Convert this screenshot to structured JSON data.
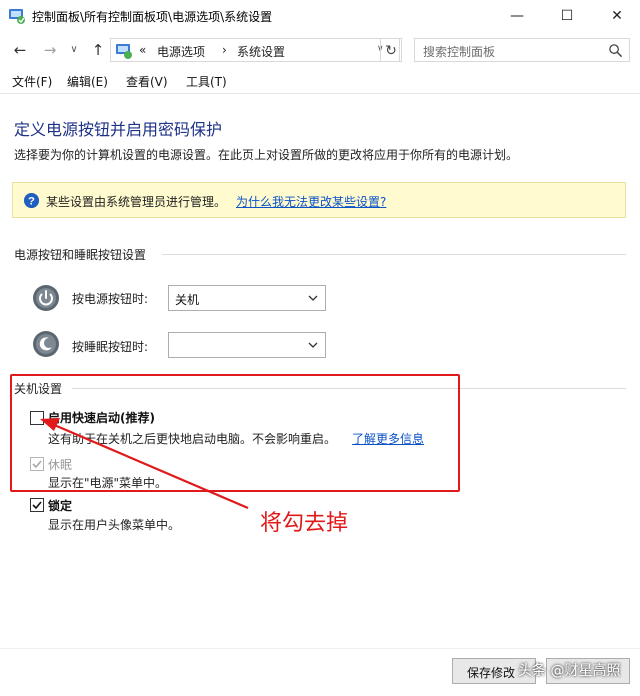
{
  "window": {
    "title": "控制面板\\所有控制面板项\\电源选项\\系统设置",
    "minimize": "—",
    "maximize": "☐",
    "close": "✕"
  },
  "nav": {
    "back": "←",
    "forward": "→",
    "dropdown": "∨",
    "up": "↑",
    "chevron": "«",
    "crumb1": "电源选项",
    "separator": "›",
    "crumb2": "系统设置",
    "address_dropdown": "∨",
    "refresh": "↻",
    "search_placeholder": "搜索控制面板"
  },
  "menu": [
    "文件(F)",
    "编辑(E)",
    "查看(V)",
    "工具(T)"
  ],
  "page": {
    "title": "定义电源按钮并启用密码保护",
    "description": "选择要为你的计算机设置的电源设置。在此页上对设置所做的更改将应用于你所有的电源计划。"
  },
  "info_bar": {
    "text": "某些设置由系统管理员进行管理。",
    "link": "为什么我无法更改某些设置?"
  },
  "buttons_section": {
    "heading": "电源按钮和睡眠按钮设置",
    "power_label": "按电源按钮时:",
    "power_value": "关机",
    "sleep_label": "按睡眠按钮时:",
    "sleep_value": ""
  },
  "shutdown_section": {
    "heading": "关机设置",
    "options": [
      {
        "label": "启用快速启动(推荐)",
        "checked": false,
        "enabled": true,
        "desc": "这有助于在关机之后更快地启动电脑。不会影响重启。",
        "link": "了解更多信息"
      },
      {
        "label": "休眠",
        "checked": true,
        "enabled": false,
        "desc": "显示在\"电源\"菜单中。"
      },
      {
        "label": "锁定",
        "checked": true,
        "enabled": true,
        "desc": "显示在用户头像菜单中。"
      }
    ]
  },
  "annotation": {
    "text": "将勾去掉",
    "color": "#e0191a"
  },
  "footer": {
    "save": "保存修改",
    "watermark": "头条 @财星高照"
  },
  "icons": {
    "app": "control-panel-icon",
    "search": "search-icon",
    "info": "question-icon",
    "power": "power-icon",
    "sleep": "sleep-icon"
  },
  "colors": {
    "title": "#1e3287",
    "link": "#0b52c8",
    "info_bg": "#fffbcf",
    "annotation": "#e0191a"
  }
}
